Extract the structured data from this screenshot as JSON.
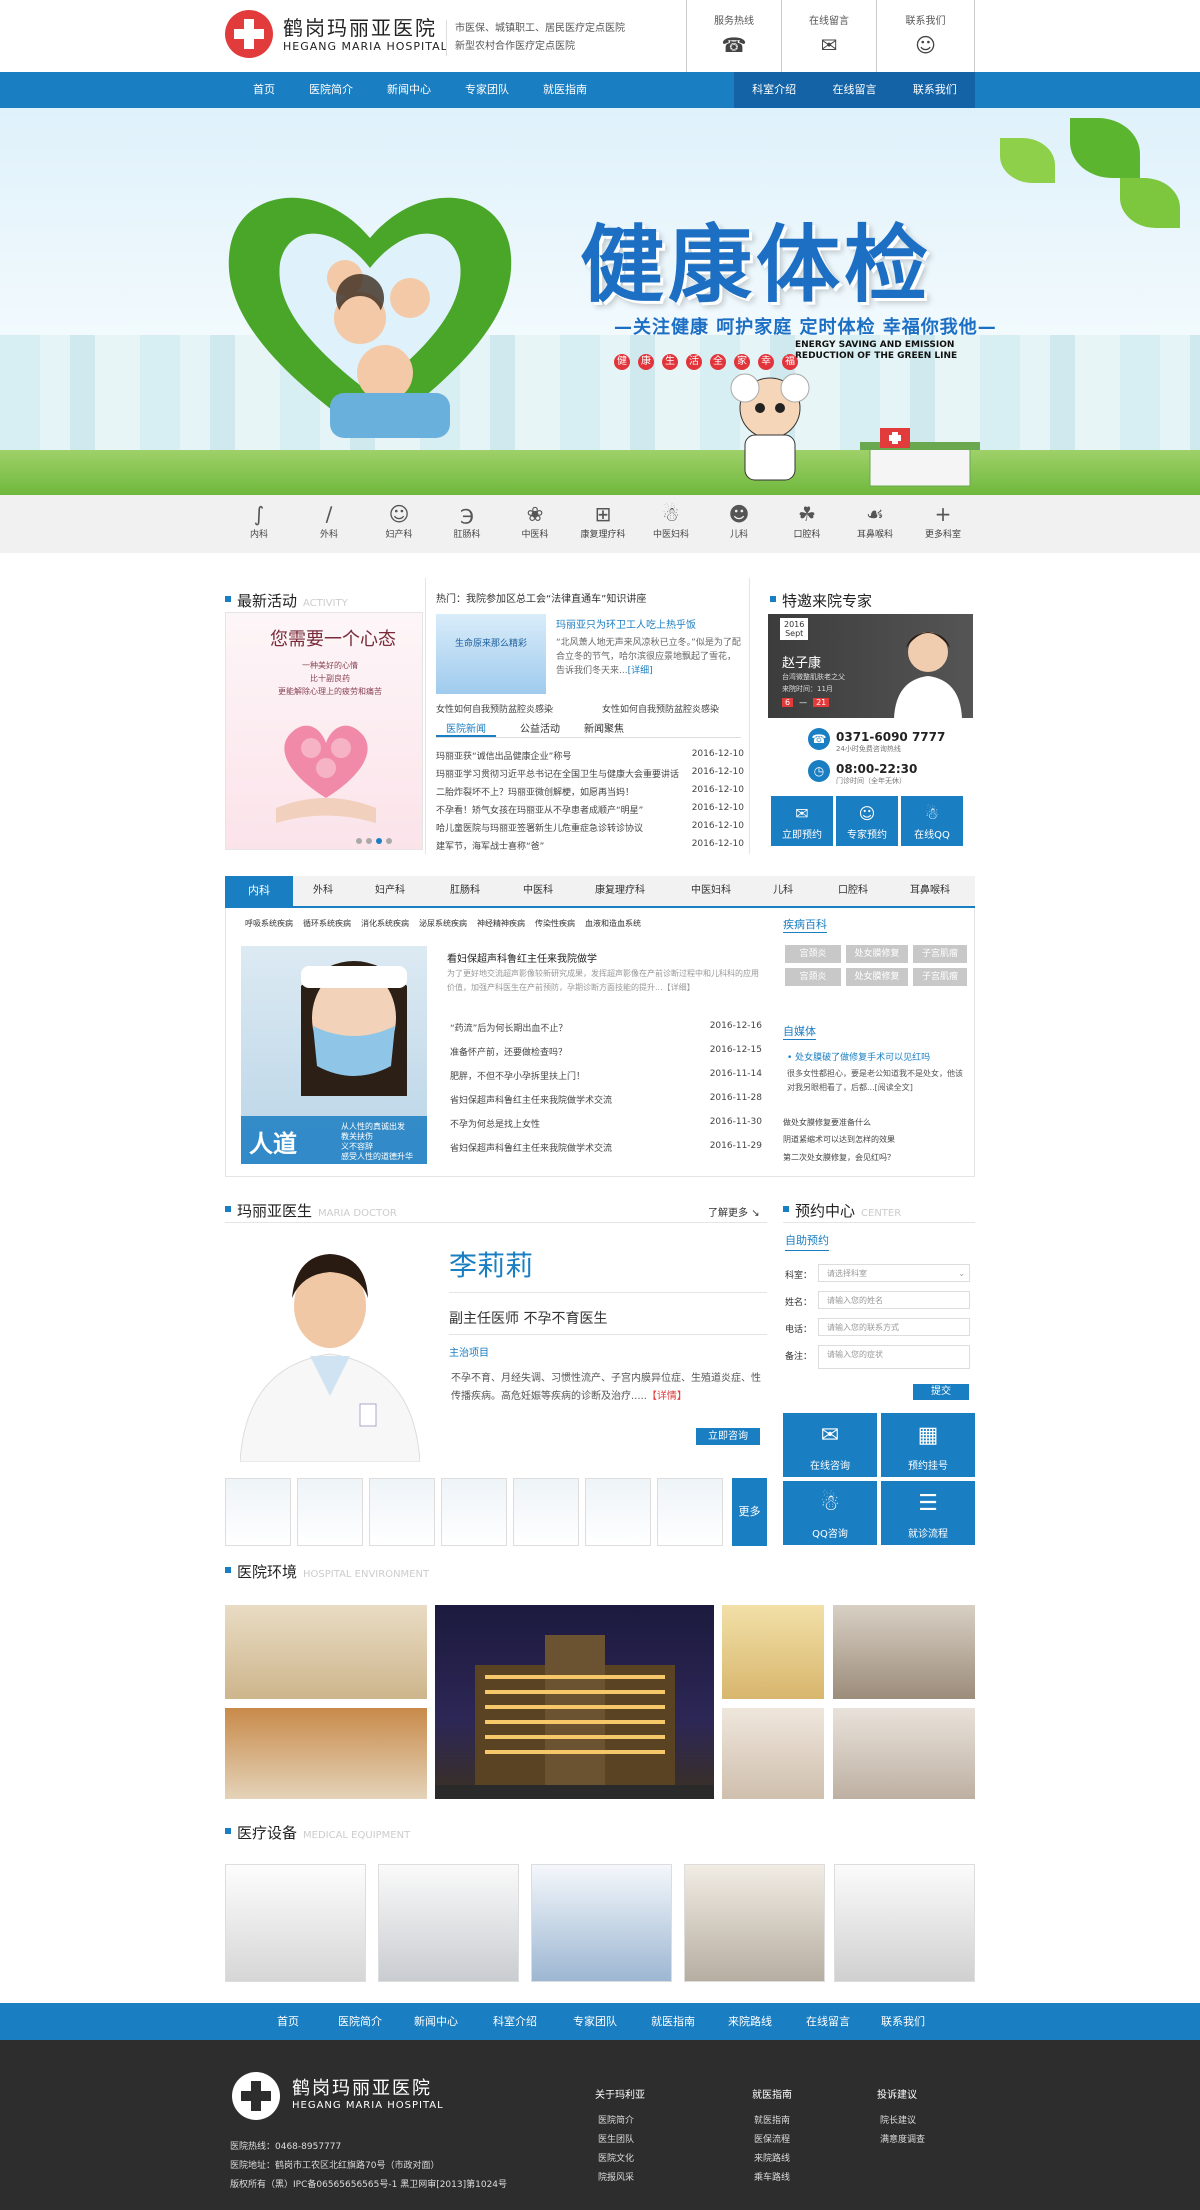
{
  "header": {
    "logo_cn": "鹤岗玛丽亚医院",
    "logo_en": "HEGANG MARIA HOSPITAL",
    "tagline_1": "市医保、城镇职工、居民医疗定点医院",
    "tagline_2": "新型农村合作医疗定点医院",
    "buttons": [
      {
        "label": "服务热线",
        "icon": "phone-icon"
      },
      {
        "label": "在线留言",
        "icon": "chat-bubble-icon"
      },
      {
        "label": "联系我们",
        "icon": "people-icon"
      }
    ]
  },
  "nav": {
    "left": [
      "首页",
      "医院简介",
      "新闻中心",
      "专家团队",
      "就医指南"
    ],
    "right": [
      "科室介绍",
      "在线留言",
      "联系我们"
    ]
  },
  "banner": {
    "title": "健康体检",
    "subtitle": "—关注健康 呵护家庭 定时体检 幸福你我他—",
    "en_line1": "ENERGY SAVING AND EMISSION",
    "en_line2": "REDUCTION OF THE GREEN LINE",
    "tags": [
      "健",
      "康",
      "生",
      "活",
      "全",
      "家",
      "幸",
      "福"
    ]
  },
  "departments": [
    {
      "label": "内科",
      "icon": "stomach-icon"
    },
    {
      "label": "外科",
      "icon": "scalpel-icon"
    },
    {
      "label": "妇产科",
      "icon": "female-icon"
    },
    {
      "label": "肛肠科",
      "icon": "intestine-icon"
    },
    {
      "label": "中医科",
      "icon": "herb-icon"
    },
    {
      "label": "康复理疗科",
      "icon": "medkit-icon"
    },
    {
      "label": "中医妇科",
      "icon": "uterus-icon"
    },
    {
      "label": "儿科",
      "icon": "baby-icon"
    },
    {
      "label": "口腔科",
      "icon": "tooth-icon"
    },
    {
      "label": "耳鼻喉科",
      "icon": "ear-icon"
    },
    {
      "label": "更多科室",
      "icon": "plus-icon"
    }
  ],
  "activity": {
    "title": "最新活动",
    "title_en": "ACTIVITY",
    "poster_title": "您需要一个心态",
    "poster_lines": [
      "一种美好的心情",
      "比十副良药",
      "更能解除心理上的疲劳和痛苦"
    ]
  },
  "news": {
    "hot": "热门：我院参加区总工会“法律直通车”知识讲座",
    "feature_title": "玛丽亚只为环卫工人吃上热乎饭",
    "feature_text": "“北风萧人地无声来风凉秋已立冬。”似是为了配合立冬的节气，哈尔滨很应景地飘起了雪花，告诉我们冬天来...",
    "feature_more": "[详细]",
    "feature_img_text": "生命原来那么精彩",
    "link_left": "女性如何自我预防盆腔炎感染",
    "link_right": "女性如何自我预防盆腔炎感染",
    "tabs": [
      "医院新闻",
      "公益活动",
      "新闻聚焦"
    ],
    "items": [
      {
        "title": "玛丽亚获“诚信出品健康企业”称号",
        "date": "2016-12-10"
      },
      {
        "title": "玛丽亚学习贯彻习近平总书记在全国卫生与健康大会重要讲话",
        "date": "2016-12-10"
      },
      {
        "title": "二胎炸裂坏不上？玛丽亚微创解梗，如愿再当妈！",
        "date": "2016-12-10"
      },
      {
        "title": "不孕看！矫气女孩在玛丽亚从不孕患者成顺产“明星”",
        "date": "2016-12-10"
      },
      {
        "title": "哈儿童医院与玛丽亚签署新生儿危重症急诊转诊协议",
        "date": "2016-12-10"
      },
      {
        "title": "建军节，海军战士喜称“爸”",
        "date": "2016-12-10"
      }
    ]
  },
  "experts_special": {
    "title": "特邀来院专家",
    "date_year": "2016",
    "date_month": "Sept",
    "name": "赵子康",
    "desc": "台湾微整肌肤老之父",
    "visit": "来院时间：11月",
    "day_from": "6",
    "day_to": "21",
    "phone": "0371-6090 7777",
    "phone_note": "24小时免费咨询热线",
    "hours": "08:00-22:30",
    "hours_note": "门诊时间（全年无休）",
    "buttons": [
      "立即预约",
      "专家预约",
      "在线QQ"
    ]
  },
  "dept_tabs": {
    "tabs": [
      "内科",
      "外科",
      "妇产科",
      "肛肠科",
      "中医科",
      "康复理疗科",
      "中医妇科",
      "儿科",
      "口腔科",
      "耳鼻喉科"
    ],
    "subtabs": [
      "呼吸系统疾病",
      "循环系统疾病",
      "消化系统疾病",
      "泌尿系统疾病",
      "神经精神疾病",
      "传染性疾病",
      "血液和造血系统"
    ],
    "feature_title": "看妇保超声科鲁红主任来我院做学",
    "feature_text": "为了更好地交流超声影像较新研究成果，发挥超声影像在产前诊断过程中和儿科科的应用价值，加强产科医生在产前预防，孕期诊断方面技能的提升...【详细】",
    "img_caption_big": "人道",
    "img_caption_lines": [
      "从人性的真诚出发",
      "教关扶伤",
      "义不容辞",
      "感受人性的道德升华"
    ],
    "items": [
      {
        "title": "“药流”后为何长期出血不止？",
        "date": "2016-12-16"
      },
      {
        "title": "准备怀产前，还要做检查吗？",
        "date": "2016-12-15"
      },
      {
        "title": "肥胖，不但不孕小孕拆里扶上门！",
        "date": "2016-11-14"
      },
      {
        "title": "省妇保超声科鲁红主任来我院做学术交流",
        "date": "2016-11-28"
      },
      {
        "title": "不孕为何总是找上女性",
        "date": "2016-11-30"
      },
      {
        "title": "省妇保超声科鲁红主任来我院做学术交流",
        "date": "2016-11-29"
      }
    ],
    "disease_title": "疾病百科",
    "disease_tags": [
      "宫颈炎",
      "处女膜修复",
      "子宫肌瘤",
      "宫颈炎",
      "处女膜修复",
      "子宫肌瘤"
    ],
    "media_title": "自媒体",
    "media_headline": "处女膜破了做修复手术可以见红吗",
    "media_text": "很多女性都担心，要是老公知道我不是处女，他该对我另眼相看了，后都...[阅读全文]",
    "media_links": [
      "做处女膜修复要准备什么",
      "阴道紧缩术可以达到怎样的效果",
      "第二次处女膜修复，会见红吗？"
    ]
  },
  "doctor": {
    "section_title": "玛丽亚医生",
    "section_en": "MARIA DOCTOR",
    "more": "了解更多",
    "name": "李莉莉",
    "title": "副主任医师 不孕不育医生",
    "expertise_label": "主治项目",
    "expertise": "不孕不育、月经失调、习惯性流产、子宫内膜异位症、生殖道炎症、性传播疾病。高危妊娠等疾病的诊断及治疗.....",
    "detail": "【详情】",
    "consult": "立即咨询",
    "more_btn": "更多"
  },
  "appointment": {
    "title": "预约中心",
    "title_en": "CENTER",
    "tab": "自助预约",
    "fields": [
      {
        "label": "科室：",
        "placeholder": "请选择科室"
      },
      {
        "label": "姓名：",
        "placeholder": "请输入您的姓名"
      },
      {
        "label": "电话：",
        "placeholder": "请输入您的联系方式"
      },
      {
        "label": "备注：",
        "placeholder": "请输入您的症状"
      }
    ],
    "submit": "提交",
    "tiles": [
      {
        "label": "在线咨询",
        "icon": "chat-bubble-icon"
      },
      {
        "label": "预约挂号",
        "icon": "calendar-icon"
      },
      {
        "label": "QQ咨询",
        "icon": "qq-icon"
      },
      {
        "label": "就诊流程",
        "icon": "document-icon"
      }
    ]
  },
  "environment": {
    "title": "医院环境",
    "title_en": "HOSPITAL ENVIRONMENT"
  },
  "equipment": {
    "title": "医疗设备",
    "title_en": "MEDICAL EQUIPMENT"
  },
  "footer_nav": [
    "首页",
    "医院简介",
    "新闻中心",
    "科室介绍",
    "专家团队",
    "就医指南",
    "来院路线",
    "在线留言",
    "联系我们"
  ],
  "footer": {
    "logo_cn": "鹤岗玛丽亚医院",
    "logo_en": "HEGANG MARIA HOSPITAL",
    "phone": "医院热线：0468-8957777",
    "address": "医院地址：鹤岗市工农区北红旗路70号（市政对面）",
    "copyright": "版权所有（黑）IPC备06565656565号-1 黑卫网审[2013]第1024号",
    "cols": [
      {
        "title": "关于玛利亚",
        "links": [
          "医院简介",
          "医生团队",
          "医院文化",
          "院报风采"
        ]
      },
      {
        "title": "就医指南",
        "links": [
          "就医指南",
          "医保流程",
          "来院路线",
          "乘车路线"
        ]
      },
      {
        "title": "投诉建议",
        "links": [
          "院长建议",
          "满意度调查"
        ]
      }
    ]
  },
  "colors": {
    "brand_blue": "#1a7ec2",
    "brand_dark": "#1363a6",
    "logo_red": "#e23b3b",
    "footer_bg": "#2d2d2d"
  }
}
